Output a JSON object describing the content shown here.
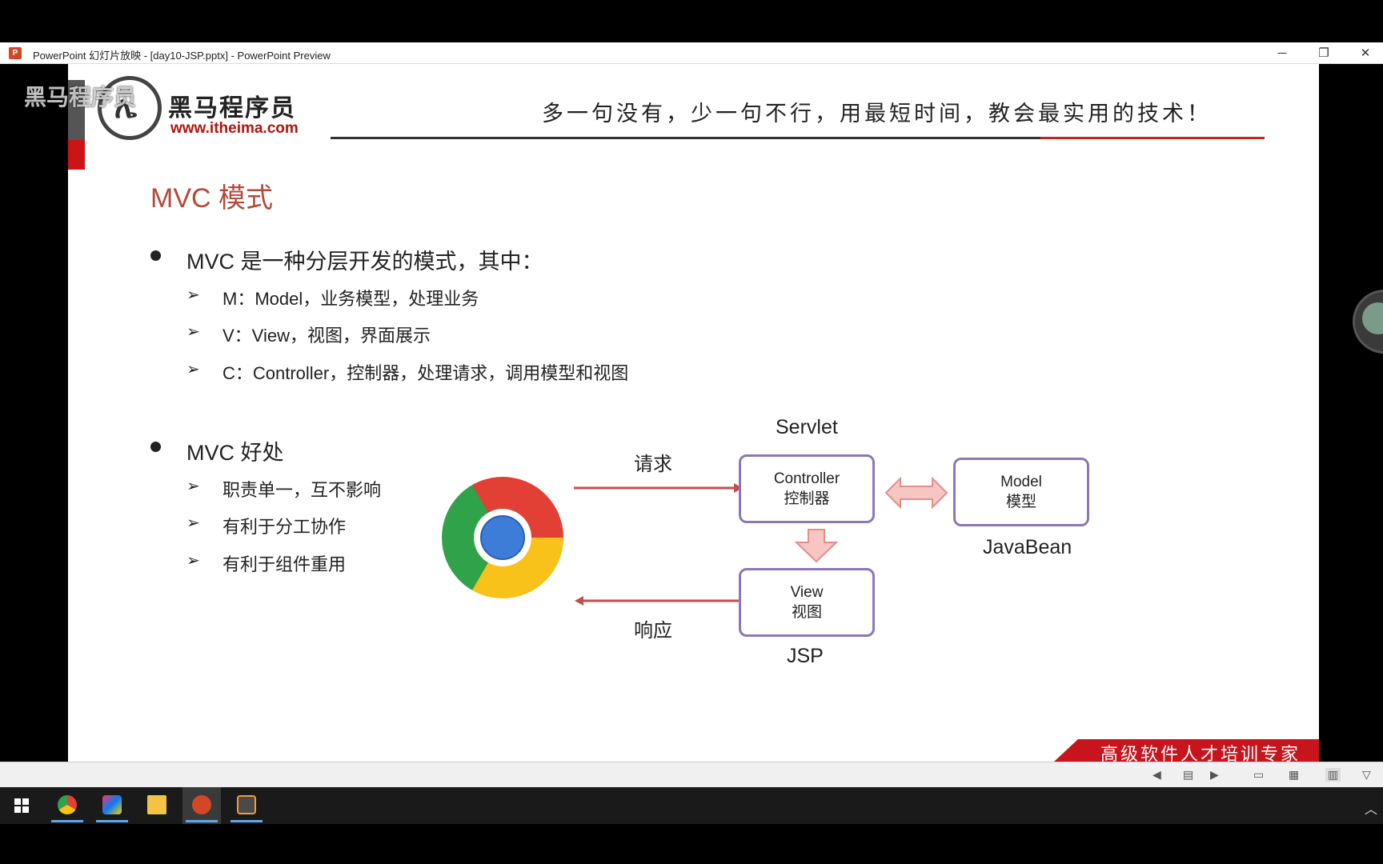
{
  "window": {
    "title": "PowerPoint 幻灯片放映 - [day10-JSP.pptx] - PowerPoint Preview",
    "app_icon": "P",
    "minimize_label": "─",
    "restore_label": "❐",
    "close_label": "✕"
  },
  "watermark": {
    "text": "黑马程序员"
  },
  "slide": {
    "logo_text": "黑马程序员",
    "logo_url": "www.itheima.com",
    "slogan": "多一句没有，少一句不行，用最短时间，教会最实用的技术！",
    "title": "MVC 模式",
    "bullet1": {
      "text": "MVC 是一种分层开发的模式，其中：",
      "subs": [
        "M：Model，业务模型，处理业务",
        "V：View，视图，界面展示",
        "C：Controller，控制器，处理请求，调用模型和视图"
      ]
    },
    "bullet2": {
      "text": "MVC 好处",
      "subs": [
        "职责单一，互不影响",
        "有利于分工协作",
        "有利于组件重用"
      ]
    },
    "arrow_glyph": "➢",
    "diagram": {
      "servlet_label": "Servlet",
      "request_label": "请求",
      "response_label": "响应",
      "controller_en": "Controller",
      "controller_zh": "控制器",
      "model_en": "Model",
      "model_zh": "模型",
      "javabean_label": "JavaBean",
      "view_en": "View",
      "view_zh": "视图",
      "jsp_label": "JSP"
    },
    "footer_banner": "高级软件人才培训专家"
  },
  "colors": {
    "title_red": "#b34a3a",
    "brand_red": "#c8141c",
    "box_border": "#8c78b4",
    "arrow_red": "#c0504d",
    "arrow_pink": "#f4a6a6"
  },
  "taskbar": {
    "items": [
      "windows-start-icon",
      "chrome-icon",
      "intellij-icon",
      "file-explorer-icon",
      "powerpoint-icon",
      "sublime-icon"
    ]
  }
}
